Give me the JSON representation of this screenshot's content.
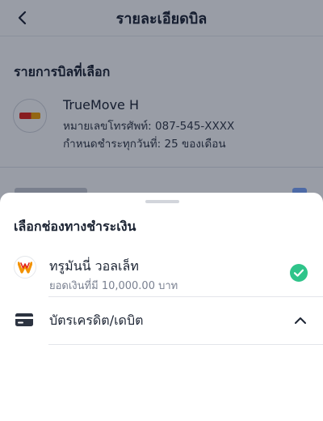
{
  "header": {
    "title": "รายละเอียดบิล"
  },
  "bill": {
    "section_title": "รายการบิลที่เลือก",
    "provider_name": "TrueMove H",
    "phone_line": "หมายเลขโทรศัพท์: 087-545-XXXX",
    "due_line": "กำหนดชำระทุกวันที่: 25 ของเดือน"
  },
  "sheet": {
    "title": "เลือกช่องทางชำระเงิน",
    "options": [
      {
        "label": "ทรูมันนี่ วอลเล็ท",
        "sublabel": "ยอดเงินที่มี 10,000.00 บาท",
        "icon": "truemoney-wallet-icon",
        "selected": true
      },
      {
        "label": "บัตรเครดิต/เดบิต",
        "icon": "credit-card-icon",
        "expanded": true
      }
    ]
  },
  "colors": {
    "check": "#2fc48a",
    "overlay": "rgba(12,22,44,0.42)",
    "text": "#1c2433",
    "subtext": "#7a8191"
  }
}
